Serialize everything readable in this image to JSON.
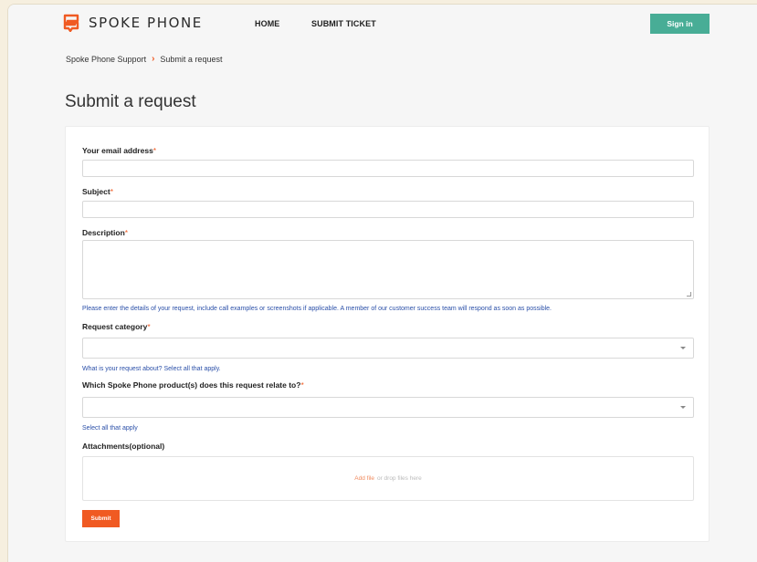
{
  "header": {
    "logo_text": "SPOKE PHONE",
    "logo_icon": "spoke-speech-bubble-icon",
    "nav": {
      "home": "HOME",
      "submit_ticket": "SUBMIT TICKET"
    },
    "sign_in": "Sign in"
  },
  "breadcrumb": {
    "root": "Spoke Phone Support",
    "separator_icon": "chevron-right-icon",
    "current": "Submit a request"
  },
  "page_title": "Submit a request",
  "form": {
    "email": {
      "label": "Your email address",
      "required_mark": "*",
      "value": ""
    },
    "subject": {
      "label": "Subject",
      "required_mark": "*",
      "value": ""
    },
    "description": {
      "label": "Description",
      "required_mark": "*",
      "value": "",
      "hint": "Please enter the details of your request, include call examples or screenshots if applicable. A member of our customer success team will respond as soon as possible."
    },
    "category": {
      "label": "Request category",
      "required_mark": "*",
      "value": "",
      "hint": "What is your request about? Select all that apply."
    },
    "product": {
      "label": "Which Spoke Phone product(s) does this request relate to?",
      "required_mark": "*",
      "value": "",
      "hint": "Select all that apply"
    },
    "attachments": {
      "label": "Attachments(optional)",
      "add_file": "Add file",
      "drop_text": "or drop files here"
    },
    "submit": "Submit"
  },
  "colors": {
    "accent": "#f05a22",
    "sign_in_bg": "#48ad96",
    "hint_text": "#2a4fa8",
    "page_bg": "#f6f6f6",
    "outer_bg": "#f6efdf"
  }
}
